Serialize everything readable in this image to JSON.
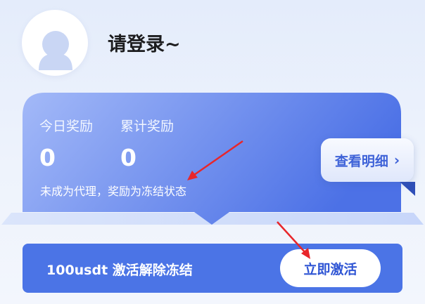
{
  "header": {
    "login_text": "请登录~"
  },
  "rewards": {
    "today_label": "今日奖励",
    "today_value": "0",
    "total_label": "累计奖励",
    "total_value": "0",
    "note": "未成为代理，奖励为冻结状态",
    "details_button": "查看明细"
  },
  "activation": {
    "text": "100usdt 激活解除冻结",
    "button": "立即激活"
  },
  "icons": {
    "avatar": "user-silhouette-icon",
    "details_chevron": "chevron-right-icon",
    "annotation": "red-arrow-icon"
  },
  "colors": {
    "card_blue": "#4d74e8",
    "card_light": "#9fb6f7",
    "accent_text": "#2f55d4",
    "annotation_red": "#e8262b"
  }
}
